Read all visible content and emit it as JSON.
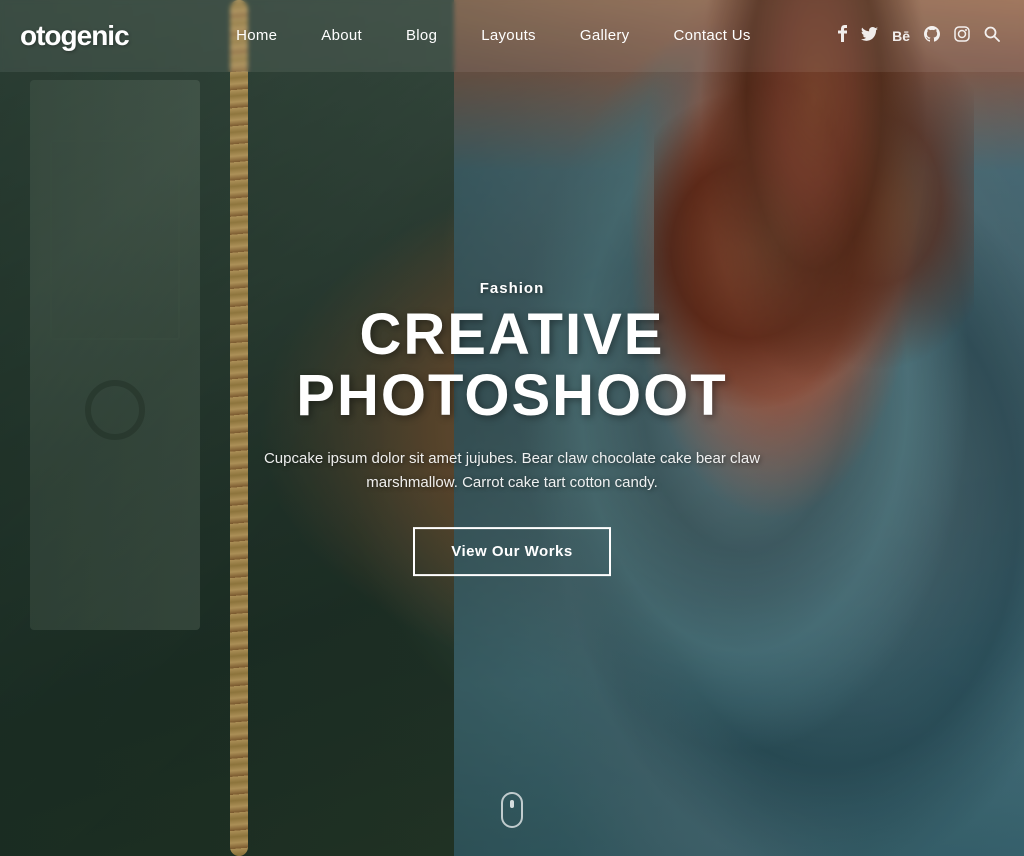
{
  "brand": {
    "logo": "otogenic",
    "logo_full": "Photogenic"
  },
  "navbar": {
    "links": [
      {
        "id": "home",
        "label": "Home"
      },
      {
        "id": "about",
        "label": "About"
      },
      {
        "id": "blog",
        "label": "Blog"
      },
      {
        "id": "layouts",
        "label": "Layouts"
      },
      {
        "id": "gallery",
        "label": "Gallery"
      },
      {
        "id": "contact",
        "label": "Contact Us"
      }
    ],
    "social": [
      {
        "id": "facebook",
        "icon": "f",
        "symbol": "𝐟"
      },
      {
        "id": "twitter",
        "icon": "t",
        "symbol": "🐦"
      },
      {
        "id": "behance",
        "icon": "Be",
        "symbol": "Bē"
      },
      {
        "id": "github",
        "icon": "gh",
        "symbol": "⌥"
      },
      {
        "id": "instagram",
        "icon": "ig",
        "symbol": "◎"
      },
      {
        "id": "search",
        "icon": "search",
        "symbol": "🔍"
      }
    ]
  },
  "hero": {
    "category": "Fashion",
    "title": "CREATIVE PHOTOSHOOT",
    "description": "Cupcake ipsum dolor sit amet jujubes. Bear claw chocolate cake bear claw marshmallow. Carrot cake tart cotton candy.",
    "cta_label": "View Our Works"
  },
  "colors": {
    "accent": "#ffffff",
    "overlay": "rgba(20,40,30,0.4)",
    "brand": "#ffffff"
  }
}
